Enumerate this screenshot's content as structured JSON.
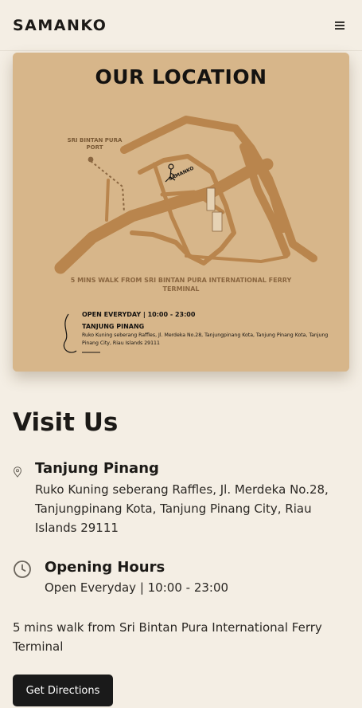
{
  "header": {
    "brand": "SAMANKO",
    "menu_icon": "hamburger-menu-icon"
  },
  "map": {
    "title": "OUR LOCATION",
    "port_label": "SRI BINTAN PURA PORT",
    "shop_label": "SAMANKO",
    "walk_note": "5 MINS WALK FROM SRI BINTAN PURA INTERNATIONAL FERRY TERMINAL",
    "hours": "OPEN EVERYDAY | 10:00 - 23:00",
    "city": "TANJUNG PINANG",
    "address": "Ruko Kuning seberang Raffles, Jl. Merdeka No.28, Tanjungpinang Kota, Tanjung Pinang Kota, Tanjung Pinang City, Riau Islands 29111",
    "colors": {
      "paper": "#d7b68a",
      "road": "#b9854d",
      "ink": "#141210"
    }
  },
  "visit": {
    "heading": "Visit Us",
    "location": {
      "icon": "location-pin-icon",
      "title": "Tanjung Pinang",
      "address": "Ruko Kuning seberang Raffles, Jl. Merdeka No.28, Tanjungpinang Kota, Tanjung Pinang City, Riau Islands 29111"
    },
    "hours": {
      "icon": "clock-icon",
      "title": "Opening Hours",
      "text": "Open Everyday | 10:00 - 23:00"
    },
    "walk_note": "5 mins walk from Sri Bintan Pura International Ferry Terminal",
    "directions_button": "Get Directions"
  }
}
